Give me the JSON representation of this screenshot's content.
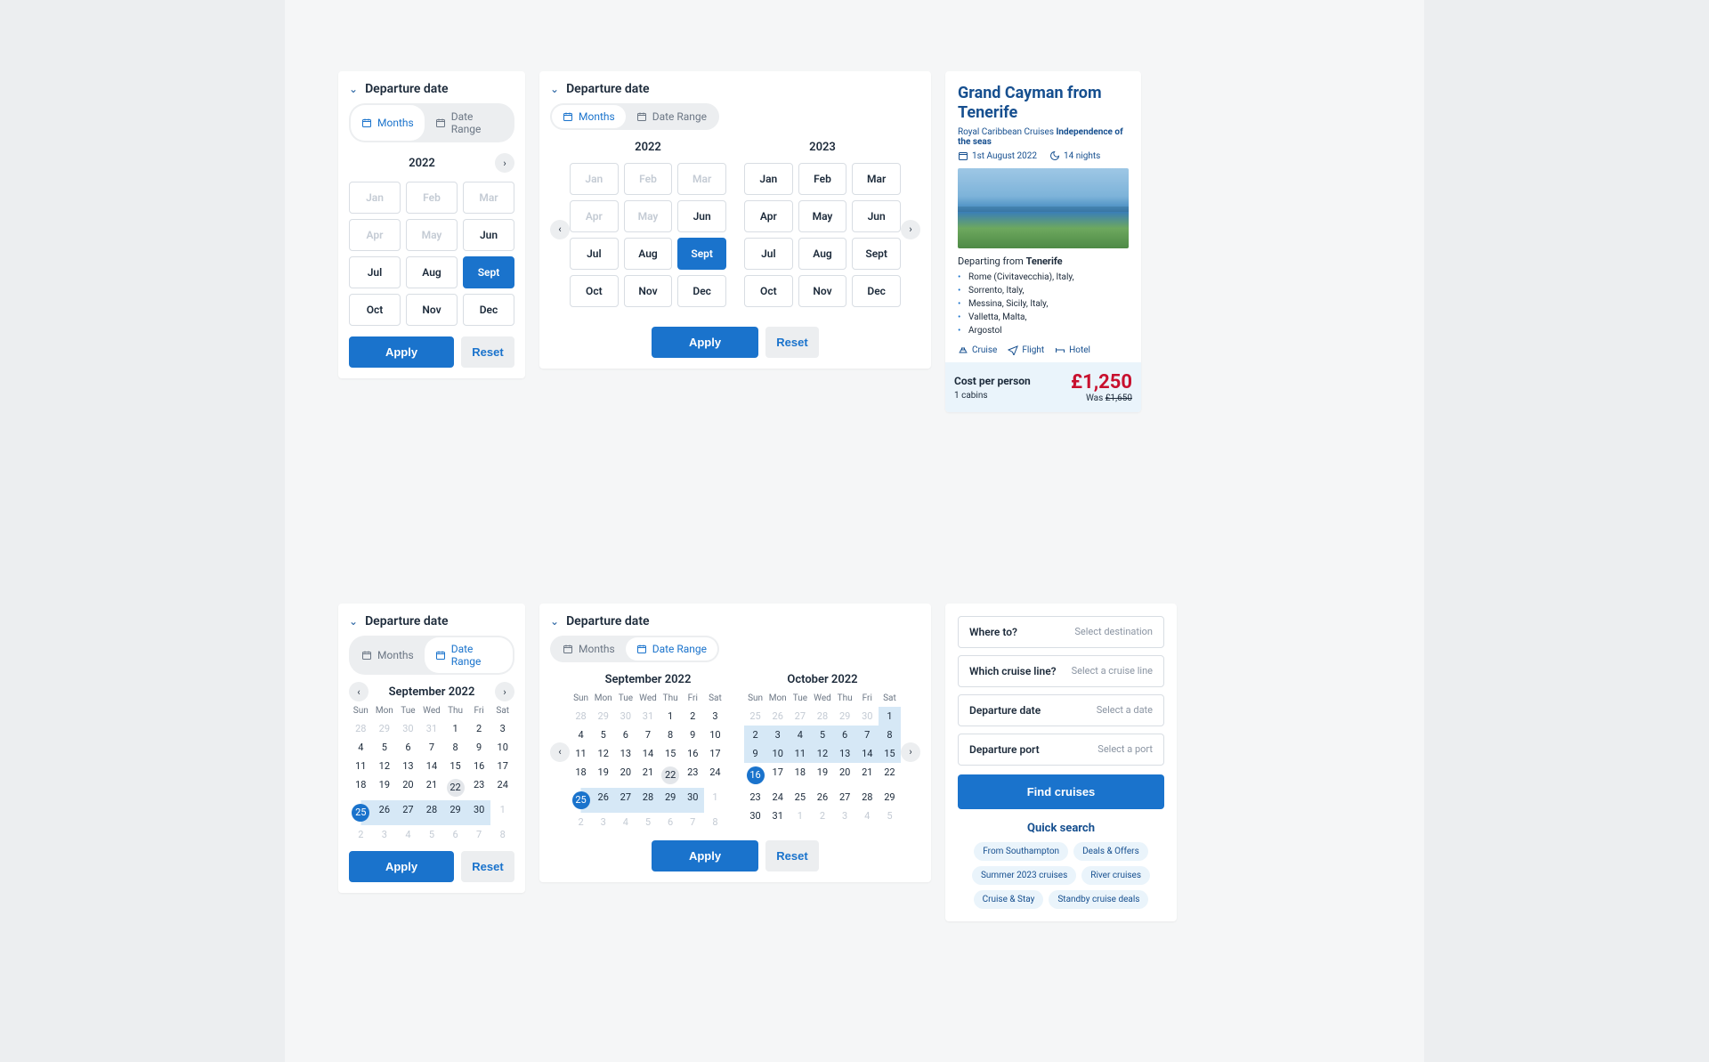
{
  "monthPicker1": {
    "title": "Departure date",
    "toggle": {
      "months": "Months",
      "dateRange": "Date Range"
    },
    "year": "2022",
    "months": [
      {
        "label": "Jan",
        "state": "disabled"
      },
      {
        "label": "Feb",
        "state": "disabled"
      },
      {
        "label": "Mar",
        "state": "disabled"
      },
      {
        "label": "Apr",
        "state": "disabled"
      },
      {
        "label": "May",
        "state": "disabled"
      },
      {
        "label": "Jun",
        "state": ""
      },
      {
        "label": "Jul",
        "state": ""
      },
      {
        "label": "Aug",
        "state": ""
      },
      {
        "label": "Sept",
        "state": "selected"
      },
      {
        "label": "Oct",
        "state": ""
      },
      {
        "label": "Nov",
        "state": ""
      },
      {
        "label": "Dec",
        "state": ""
      }
    ],
    "apply": "Apply",
    "reset": "Reset"
  },
  "monthPicker2": {
    "title": "Departure date",
    "toggle": {
      "months": "Months",
      "dateRange": "Date Range"
    },
    "years": [
      {
        "year": "2022",
        "months": [
          {
            "label": "Jan",
            "state": "disabled"
          },
          {
            "label": "Feb",
            "state": "disabled"
          },
          {
            "label": "Mar",
            "state": "disabled"
          },
          {
            "label": "Apr",
            "state": "disabled"
          },
          {
            "label": "May",
            "state": "disabled"
          },
          {
            "label": "Jun",
            "state": ""
          },
          {
            "label": "Jul",
            "state": ""
          },
          {
            "label": "Aug",
            "state": ""
          },
          {
            "label": "Sept",
            "state": "selected"
          },
          {
            "label": "Oct",
            "state": ""
          },
          {
            "label": "Nov",
            "state": ""
          },
          {
            "label": "Dec",
            "state": ""
          }
        ]
      },
      {
        "year": "2023",
        "months": [
          {
            "label": "Jan",
            "state": ""
          },
          {
            "label": "Feb",
            "state": ""
          },
          {
            "label": "Mar",
            "state": ""
          },
          {
            "label": "Apr",
            "state": ""
          },
          {
            "label": "May",
            "state": ""
          },
          {
            "label": "Jun",
            "state": ""
          },
          {
            "label": "Jul",
            "state": ""
          },
          {
            "label": "Aug",
            "state": ""
          },
          {
            "label": "Sept",
            "state": ""
          },
          {
            "label": "Oct",
            "state": ""
          },
          {
            "label": "Nov",
            "state": ""
          },
          {
            "label": "Dec",
            "state": ""
          }
        ]
      }
    ],
    "apply": "Apply",
    "reset": "Reset"
  },
  "datePicker1": {
    "title": "Departure date",
    "toggle": {
      "months": "Months",
      "dateRange": "Date Range"
    },
    "monthTitle": "September 2022",
    "dow": [
      "Sun",
      "Mon",
      "Tue",
      "Wed",
      "Thu",
      "Fri",
      "Sat"
    ],
    "weeks": [
      [
        {
          "d": "28",
          "s": "muted"
        },
        {
          "d": "29",
          "s": "muted"
        },
        {
          "d": "30",
          "s": "muted"
        },
        {
          "d": "31",
          "s": "muted"
        },
        {
          "d": "1",
          "s": ""
        },
        {
          "d": "2",
          "s": ""
        },
        {
          "d": "3",
          "s": ""
        }
      ],
      [
        {
          "d": "4",
          "s": ""
        },
        {
          "d": "5",
          "s": ""
        },
        {
          "d": "6",
          "s": ""
        },
        {
          "d": "7",
          "s": ""
        },
        {
          "d": "8",
          "s": ""
        },
        {
          "d": "9",
          "s": ""
        },
        {
          "d": "10",
          "s": ""
        }
      ],
      [
        {
          "d": "11",
          "s": ""
        },
        {
          "d": "12",
          "s": ""
        },
        {
          "d": "13",
          "s": ""
        },
        {
          "d": "14",
          "s": ""
        },
        {
          "d": "15",
          "s": ""
        },
        {
          "d": "16",
          "s": ""
        },
        {
          "d": "17",
          "s": ""
        }
      ],
      [
        {
          "d": "18",
          "s": ""
        },
        {
          "d": "19",
          "s": ""
        },
        {
          "d": "20",
          "s": ""
        },
        {
          "d": "21",
          "s": ""
        },
        {
          "d": "22",
          "s": "hover-ghost"
        },
        {
          "d": "23",
          "s": ""
        },
        {
          "d": "24",
          "s": ""
        }
      ],
      [
        {
          "d": "25",
          "s": "range-start"
        },
        {
          "d": "26",
          "s": "range"
        },
        {
          "d": "27",
          "s": "range"
        },
        {
          "d": "28",
          "s": "range"
        },
        {
          "d": "29",
          "s": "range"
        },
        {
          "d": "30",
          "s": "range"
        },
        {
          "d": "1",
          "s": "muted"
        }
      ],
      [
        {
          "d": "2",
          "s": "muted"
        },
        {
          "d": "3",
          "s": "muted"
        },
        {
          "d": "4",
          "s": "muted"
        },
        {
          "d": "5",
          "s": "muted"
        },
        {
          "d": "6",
          "s": "muted"
        },
        {
          "d": "7",
          "s": "muted"
        },
        {
          "d": "8",
          "s": "muted"
        }
      ]
    ],
    "apply": "Apply",
    "reset": "Reset"
  },
  "datePicker2": {
    "title": "Departure date",
    "toggle": {
      "months": "Months",
      "dateRange": "Date Range"
    },
    "months": [
      {
        "title": "September 2022",
        "dow": [
          "Sun",
          "Mon",
          "Tue",
          "Wed",
          "Thu",
          "Fri",
          "Sat"
        ],
        "weeks": [
          [
            {
              "d": "28",
              "s": "muted"
            },
            {
              "d": "29",
              "s": "muted"
            },
            {
              "d": "30",
              "s": "muted"
            },
            {
              "d": "31",
              "s": "muted"
            },
            {
              "d": "1",
              "s": ""
            },
            {
              "d": "2",
              "s": ""
            },
            {
              "d": "3",
              "s": ""
            }
          ],
          [
            {
              "d": "4",
              "s": ""
            },
            {
              "d": "5",
              "s": ""
            },
            {
              "d": "6",
              "s": ""
            },
            {
              "d": "7",
              "s": ""
            },
            {
              "d": "8",
              "s": ""
            },
            {
              "d": "9",
              "s": ""
            },
            {
              "d": "10",
              "s": ""
            }
          ],
          [
            {
              "d": "11",
              "s": ""
            },
            {
              "d": "12",
              "s": ""
            },
            {
              "d": "13",
              "s": ""
            },
            {
              "d": "14",
              "s": ""
            },
            {
              "d": "15",
              "s": ""
            },
            {
              "d": "16",
              "s": ""
            },
            {
              "d": "17",
              "s": ""
            }
          ],
          [
            {
              "d": "18",
              "s": ""
            },
            {
              "d": "19",
              "s": ""
            },
            {
              "d": "20",
              "s": ""
            },
            {
              "d": "21",
              "s": ""
            },
            {
              "d": "22",
              "s": "hover-ghost"
            },
            {
              "d": "23",
              "s": ""
            },
            {
              "d": "24",
              "s": ""
            }
          ],
          [
            {
              "d": "25",
              "s": "range-start"
            },
            {
              "d": "26",
              "s": "range"
            },
            {
              "d": "27",
              "s": "range"
            },
            {
              "d": "28",
              "s": "range"
            },
            {
              "d": "29",
              "s": "range"
            },
            {
              "d": "30",
              "s": "range"
            },
            {
              "d": "1",
              "s": "muted"
            }
          ],
          [
            {
              "d": "2",
              "s": "muted"
            },
            {
              "d": "3",
              "s": "muted"
            },
            {
              "d": "4",
              "s": "muted"
            },
            {
              "d": "5",
              "s": "muted"
            },
            {
              "d": "6",
              "s": "muted"
            },
            {
              "d": "7",
              "s": "muted"
            },
            {
              "d": "8",
              "s": "muted"
            }
          ]
        ]
      },
      {
        "title": "October 2022",
        "dow": [
          "Sun",
          "Mon",
          "Tue",
          "Wed",
          "Thu",
          "Fri",
          "Sat"
        ],
        "weeks": [
          [
            {
              "d": "25",
              "s": "muted"
            },
            {
              "d": "26",
              "s": "muted"
            },
            {
              "d": "27",
              "s": "muted"
            },
            {
              "d": "28",
              "s": "muted"
            },
            {
              "d": "29",
              "s": "muted"
            },
            {
              "d": "30",
              "s": "muted"
            },
            {
              "d": "1",
              "s": "range"
            }
          ],
          [
            {
              "d": "2",
              "s": "range"
            },
            {
              "d": "3",
              "s": "range"
            },
            {
              "d": "4",
              "s": "range"
            },
            {
              "d": "5",
              "s": "range"
            },
            {
              "d": "6",
              "s": "range"
            },
            {
              "d": "7",
              "s": "range"
            },
            {
              "d": "8",
              "s": "range"
            }
          ],
          [
            {
              "d": "9",
              "s": "range"
            },
            {
              "d": "10",
              "s": "range"
            },
            {
              "d": "11",
              "s": "range"
            },
            {
              "d": "12",
              "s": "range"
            },
            {
              "d": "13",
              "s": "range"
            },
            {
              "d": "14",
              "s": "range"
            },
            {
              "d": "15",
              "s": "range"
            }
          ],
          [
            {
              "d": "16",
              "s": "selected"
            },
            {
              "d": "17",
              "s": ""
            },
            {
              "d": "18",
              "s": ""
            },
            {
              "d": "19",
              "s": ""
            },
            {
              "d": "20",
              "s": ""
            },
            {
              "d": "21",
              "s": ""
            },
            {
              "d": "22",
              "s": ""
            }
          ],
          [
            {
              "d": "23",
              "s": ""
            },
            {
              "d": "24",
              "s": ""
            },
            {
              "d": "25",
              "s": ""
            },
            {
              "d": "26",
              "s": ""
            },
            {
              "d": "27",
              "s": ""
            },
            {
              "d": "28",
              "s": ""
            },
            {
              "d": "29",
              "s": ""
            }
          ],
          [
            {
              "d": "30",
              "s": ""
            },
            {
              "d": "31",
              "s": ""
            },
            {
              "d": "1",
              "s": "muted"
            },
            {
              "d": "2",
              "s": "muted"
            },
            {
              "d": "3",
              "s": "muted"
            },
            {
              "d": "4",
              "s": "muted"
            },
            {
              "d": "5",
              "s": "muted"
            }
          ]
        ]
      }
    ],
    "apply": "Apply",
    "reset": "Reset"
  },
  "deal": {
    "title": "Grand Cayman from Tenerife",
    "line": "Royal Caribbean Cruises",
    "ship": "Independence of the seas",
    "date": "1st August 2022",
    "nights": "14 nights",
    "departFromLabel": "Departing from",
    "departFrom": "Tenerife",
    "stops": [
      "Rome (Civitavecchia), Italy,",
      "Sorrento, Italy,",
      "Messina, Sicily, Italy,",
      "Valletta, Malta,",
      "Argostol"
    ],
    "chips": {
      "cruise": "Cruise",
      "flight": "Flight",
      "hotel": "Hotel"
    },
    "pricePer": "Cost per person",
    "cabins": "1 cabins",
    "priceNow": "£1,250",
    "wasLabel": "Was",
    "priceWas": "£1,650"
  },
  "search": {
    "fields": [
      {
        "label": "Where to?",
        "value": "Select destination"
      },
      {
        "label": "Which cruise line?",
        "value": "Select a cruise line"
      },
      {
        "label": "Departure date",
        "value": "Select a date"
      },
      {
        "label": "Departure port",
        "value": "Select a port"
      }
    ],
    "button": "Find cruises",
    "quickTitle": "Quick search",
    "chips": [
      "From Southampton",
      "Deals & Offers",
      "Summer 2023 cruises",
      "River cruises",
      "Cruise & Stay",
      "Standby cruise deals"
    ]
  }
}
